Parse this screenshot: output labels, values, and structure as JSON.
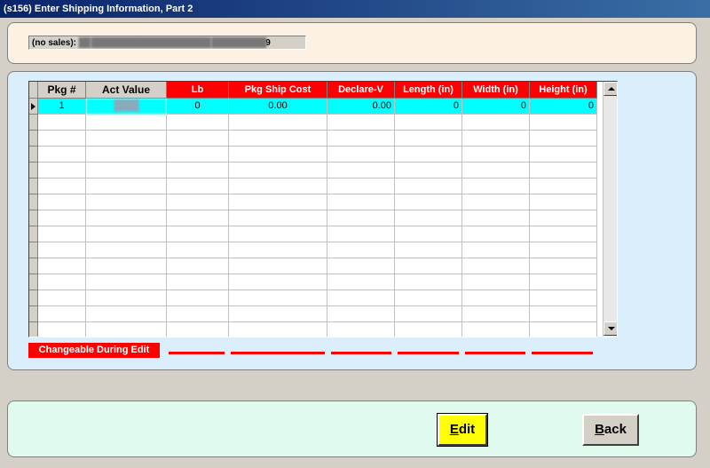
{
  "window": {
    "title": "(s156)  Enter Shipping Information, Part 2"
  },
  "info": {
    "label": "(no sales):",
    "value_blurred": "██ ██████████████████████ ██████████",
    "suffix": "9"
  },
  "grid": {
    "columns": [
      "Pkg #",
      "Act Value",
      "Lb",
      "Pkg Ship Cost",
      "Declare-V",
      "Length (in)",
      "Width (in)",
      "Height (in)"
    ],
    "changeable_columns": [
      "Lb",
      "Pkg Ship Cost",
      "Declare-V",
      "Length (in)",
      "Width (in)",
      "Height (in)"
    ],
    "rows": [
      {
        "pkg": "1",
        "act_value": "████",
        "lb": "0",
        "pkg_ship_cost": "0.00",
        "declare_v": "0.00",
        "length": "0",
        "width": "0",
        "height": "0"
      }
    ]
  },
  "legend": {
    "label": "Changeable During Edit"
  },
  "buttons": {
    "edit": "dit",
    "edit_key": "E",
    "back": "ack",
    "back_key": "B"
  },
  "colors": {
    "header_red": "#ff0000",
    "selected_row": "#00ffff",
    "edit_button": "#ffff00"
  }
}
